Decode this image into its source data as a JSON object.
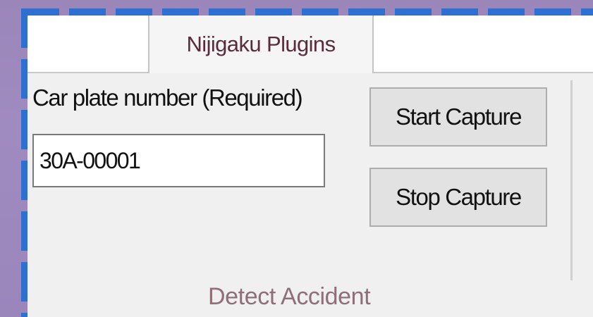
{
  "ribbon": {
    "tabs": [
      {
        "label": "Nijigaku Plugins",
        "active": true
      }
    ]
  },
  "group": {
    "label": "Detect Accident",
    "plate_label": "Car plate number (Required)",
    "plate_value": "30A-00001",
    "start_button": "Start Capture",
    "stop_button": "Stop Capture"
  },
  "colors": {
    "dashed_border": "#2f6fd0",
    "tab_text": "#5a2b3c",
    "group_label_text": "#8e6f78",
    "desktop_bg": "#9b86ba"
  }
}
